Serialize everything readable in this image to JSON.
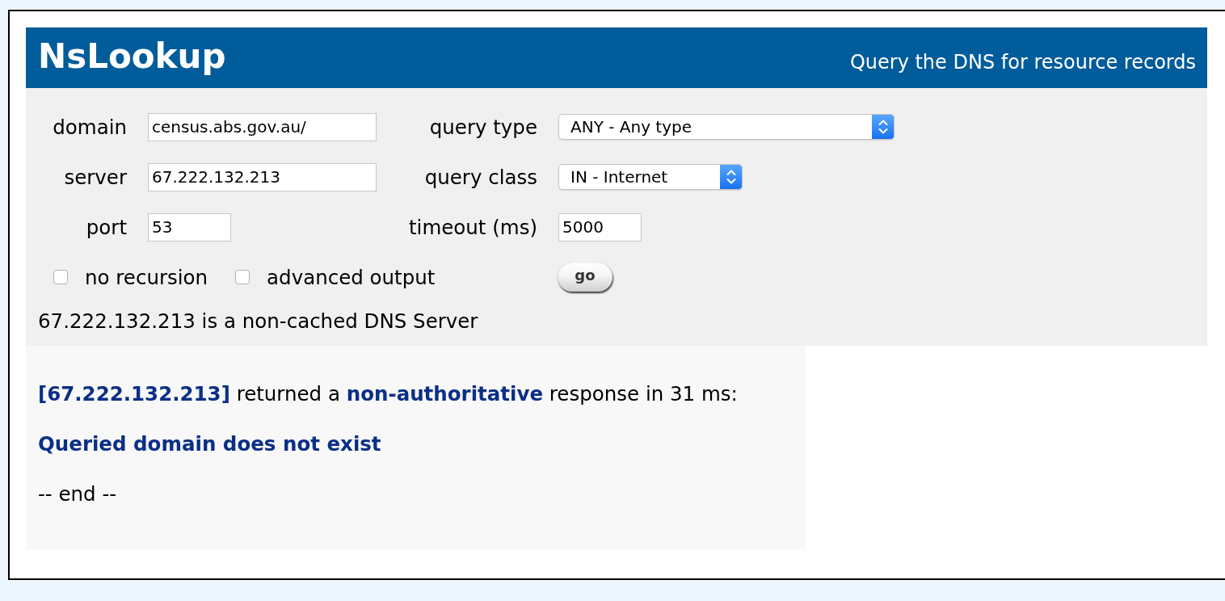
{
  "header": {
    "title": "NsLookup",
    "subtitle": "Query the DNS for resource records"
  },
  "form": {
    "fields": [
      {
        "label": "domain",
        "kind": "text",
        "value": "census.abs.gov.au/"
      },
      {
        "label": "query type",
        "kind": "select",
        "value": "ANY - Any type"
      },
      {
        "label": "server",
        "kind": "text",
        "value": "67.222.132.213"
      },
      {
        "label": "query class",
        "kind": "select",
        "value": "IN - Internet"
      },
      {
        "label": "port",
        "kind": "number",
        "value": "53"
      },
      {
        "label": "timeout (ms)",
        "kind": "number",
        "value": "5000"
      }
    ],
    "checkboxes": [
      {
        "label": "no recursion",
        "checked": false
      },
      {
        "label": "advanced output",
        "checked": false
      }
    ],
    "submit": "go",
    "status": "67.222.132.213 is a non-cached DNS Server"
  },
  "result": {
    "lines": [
      {
        "kind": "summary",
        "text": "**[67.222.132.213]** returned a **non-authoritative** response in 31 ms:"
      },
      {
        "kind": "error",
        "text": "Queried domain does not exist"
      },
      {
        "kind": "plain",
        "text": "-- end --"
      }
    ]
  }
}
